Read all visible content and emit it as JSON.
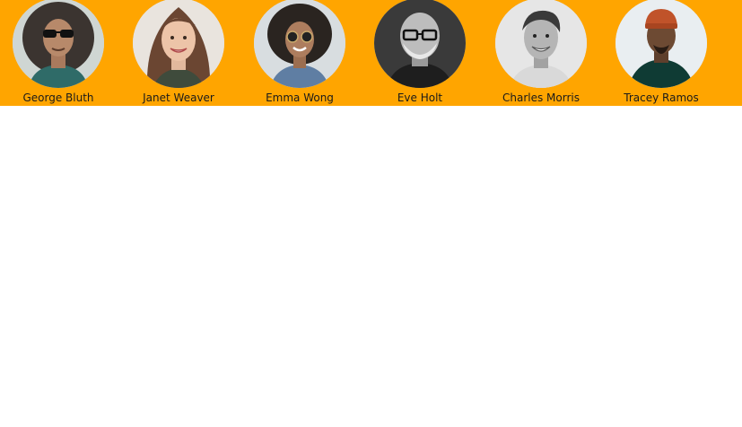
{
  "users": [
    {
      "name": "George Bluth",
      "avatar_icon": "person-avatar-icon"
    },
    {
      "name": "Janet Weaver",
      "avatar_icon": "person-avatar-icon"
    },
    {
      "name": "Emma Wong",
      "avatar_icon": "person-avatar-icon"
    },
    {
      "name": "Eve Holt",
      "avatar_icon": "person-avatar-icon"
    },
    {
      "name": "Charles Morris",
      "avatar_icon": "person-avatar-icon"
    },
    {
      "name": "Tracey Ramos",
      "avatar_icon": "person-avatar-icon"
    }
  ],
  "colors": {
    "strip_background": "#ffa500",
    "page_background": "#ffffff",
    "name_text": "#1a1a1a"
  }
}
